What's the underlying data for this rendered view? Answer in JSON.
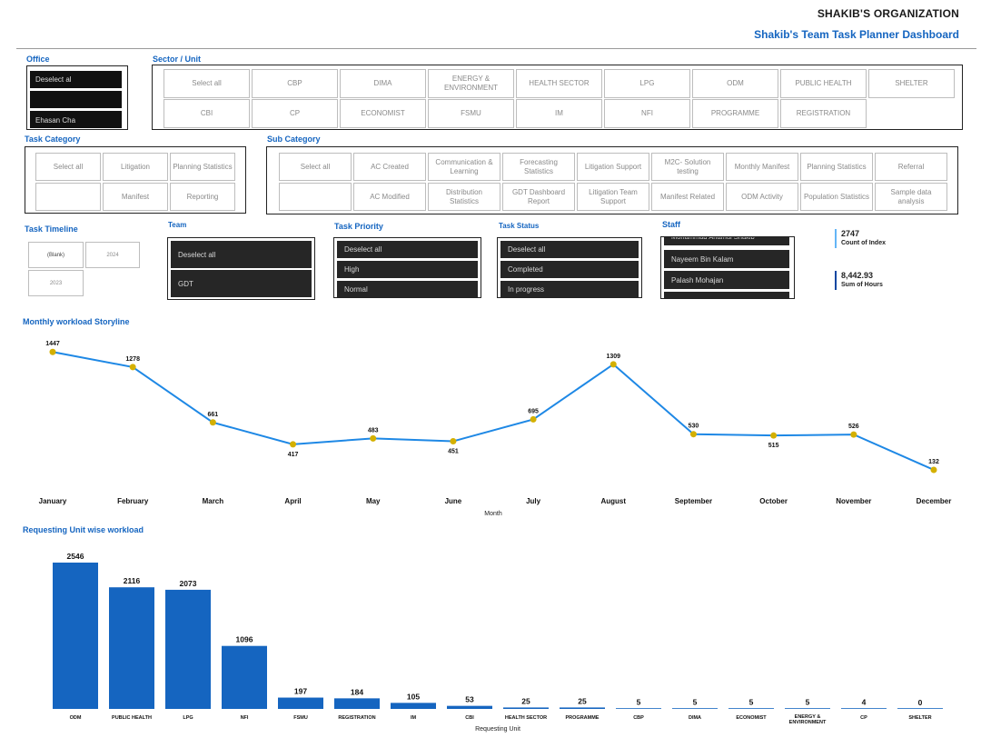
{
  "header": {
    "org": "SHAKIB'S ORGANIZATION",
    "title": "Shakib's Team Task Planner Dashboard"
  },
  "office": {
    "label": "Office",
    "items": [
      "Deselect al",
      "Ehasan Cha"
    ]
  },
  "sector": {
    "label": "Sector / Unit",
    "row1": [
      "Select all",
      "CBP",
      "DIMA",
      "ENERGY & ENVIRONMENT",
      "HEALTH SECTOR",
      "LPG",
      "ODM",
      "PUBLIC HEALTH",
      "SHELTER"
    ],
    "row2": [
      "CBI",
      "CP",
      "ECONOMIST",
      "FSMU",
      "IM",
      "NFI",
      "PROGRAMME",
      "REGISTRATION"
    ]
  },
  "task_category": {
    "label": "Task Category",
    "row1": [
      "Select all",
      "Litigation",
      "Planning Statistics"
    ],
    "row2": [
      "",
      "Manifest",
      "Reporting"
    ]
  },
  "sub_category": {
    "label": "Sub Category",
    "row1": [
      "Select all",
      "AC Created",
      "Communication & Learning",
      "Forecasting Statistics",
      "Litigation Support",
      "M2C- Solution testing",
      "Monthly Manifest",
      "Planning Statistics",
      "Referral"
    ],
    "row2": [
      "",
      "AC Modified",
      "Distribution Statistics",
      "GDT Dashboard Report",
      "Litigation Team Support",
      "Manifest Related",
      "ODM Activity",
      "Population Statistics",
      "Sample data analysis"
    ]
  },
  "timeline": {
    "label": "Task Timeline",
    "items": [
      "(Blank)",
      "2024",
      "2023"
    ]
  },
  "team": {
    "label": "Team",
    "items": [
      "Deselect all",
      "GDT"
    ]
  },
  "priority": {
    "label": "Task Priority",
    "items": [
      "Deselect all",
      "High",
      "Normal"
    ]
  },
  "status": {
    "label": "Task Status",
    "items": [
      "Deselect all",
      "Completed",
      "In progress"
    ]
  },
  "staff": {
    "label": "Staff",
    "items": [
      "Mohammad Anamul Shakib",
      "Nayeem Bin Kalam",
      "Palash Mohajan",
      "Sabbir Hossain"
    ]
  },
  "kpi": {
    "count": "2747",
    "count_label": "Count of Index",
    "hours": "8,442.93",
    "hours_label": "Sum of Hours"
  },
  "colors": {
    "accent": "#1565c0",
    "line": "#1e88e5",
    "point": "#d4b000",
    "bar": "#1565c0"
  },
  "chart_data": [
    {
      "type": "line",
      "title": "Monthly workload Storyline",
      "xlabel": "Month",
      "ylabel": "",
      "categories": [
        "January",
        "February",
        "March",
        "April",
        "May",
        "June",
        "July",
        "August",
        "September",
        "October",
        "November",
        "December"
      ],
      "values": [
        1447,
        1278,
        661,
        417,
        483,
        451,
        695,
        1309,
        530,
        515,
        526,
        132
      ],
      "ylim": [
        0,
        1500
      ],
      "grid": false
    },
    {
      "type": "bar",
      "title": "Requesting Unit wise workload",
      "xlabel": "Requesting Unit",
      "ylabel": "",
      "categories": [
        "ODM",
        "PUBLIC HEALTH",
        "LPG",
        "NFI",
        "FSMU",
        "REGISTRATION",
        "IM",
        "CBI",
        "HEALTH SECTOR",
        "PROGRAMME",
        "CBP",
        "DIMA",
        "ECONOMIST",
        "ENERGY & ENVIRONMENT",
        "CP",
        "SHELTER"
      ],
      "values": [
        2546,
        2116,
        2073,
        1096,
        197,
        184,
        105,
        53,
        25,
        25,
        5,
        5,
        5,
        5,
        4,
        0
      ],
      "ylim": [
        0,
        2546
      ],
      "grid": false
    }
  ]
}
